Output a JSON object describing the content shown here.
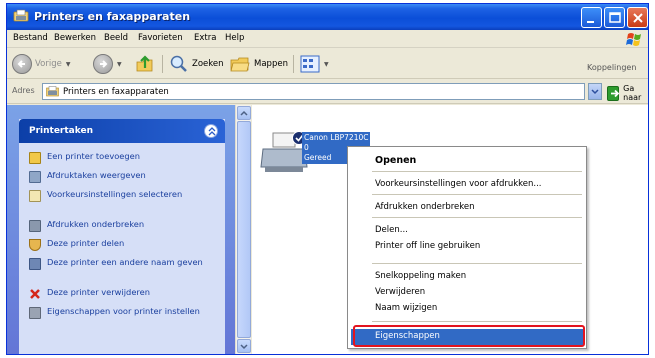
{
  "window": {
    "title": "Printers en faxapparaten"
  },
  "menubar": {
    "items": [
      "Bestand",
      "Bewerken",
      "Beeld",
      "Favorieten",
      "Extra",
      "Help"
    ]
  },
  "toolbar": {
    "back_label": "Vorige",
    "search_label": "Zoeken",
    "folders_label": "Mappen",
    "links_label": "Koppelingen"
  },
  "address": {
    "label": "Adres",
    "value": "Printers en faxapparaten",
    "go_label": "Ga naar"
  },
  "taskpane": {
    "title": "Printertaken",
    "items": [
      {
        "label": "Een printer toevoegen",
        "icon": "add-printer-icon"
      },
      {
        "label": "Afdruktaken weergeven",
        "icon": "print-jobs-icon"
      },
      {
        "label": "Voorkeursinstellingen selecteren",
        "icon": "preferences-icon"
      },
      {
        "label": "Afdrukken onderbreken",
        "icon": "pause-icon"
      },
      {
        "label": "Deze printer delen",
        "icon": "share-icon"
      },
      {
        "label": "Deze printer een andere naam geven",
        "icon": "rename-icon"
      },
      {
        "label": "Deze printer verwijderen",
        "icon": "delete-icon"
      },
      {
        "label": "Eigenschappen voor printer instellen",
        "icon": "properties-icon"
      }
    ]
  },
  "printer": {
    "name": "Canon LBP7210C",
    "docs": "0",
    "status": "Gereed"
  },
  "context_menu": {
    "items": [
      "Openen",
      "Voorkeursinstellingen voor afdrukken...",
      "Afdrukken onderbreken",
      "Delen...",
      "Printer off line gebruiken",
      "Snelkoppeling maken",
      "Verwijderen",
      "Naam wijzigen",
      "Eigenschappen"
    ],
    "highlighted": "Eigenschappen"
  },
  "colors": {
    "titlebar": "#0b4ed8",
    "selection": "#316ac5",
    "highlight_border": "#e3141f"
  }
}
